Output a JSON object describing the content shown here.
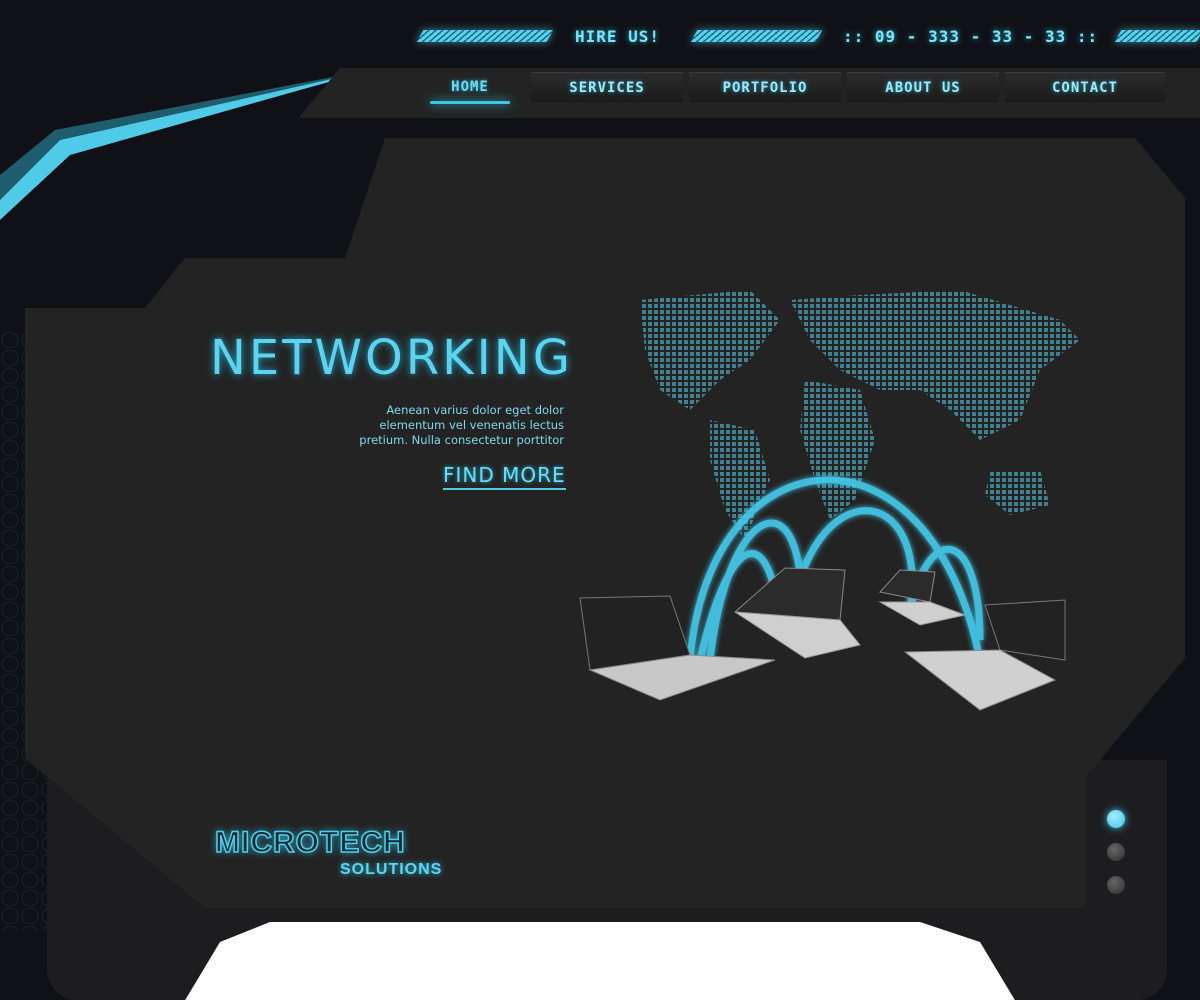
{
  "header": {
    "hire_label": "HIRE US!",
    "phone": ":: 09 - 333 - 33 - 33 ::"
  },
  "nav": {
    "items": [
      {
        "label": "HOME",
        "active": true
      },
      {
        "label": "SERVICES",
        "active": false
      },
      {
        "label": "PORTFOLIO",
        "active": false
      },
      {
        "label": "ABOUT US",
        "active": false
      },
      {
        "label": "CONTACT",
        "active": false
      }
    ]
  },
  "hero": {
    "title": "NETWORKING",
    "description_lines": [
      "Aenean varius dolor eget dolor",
      "elementum vel venenatis lectus",
      "pretium. Nulla consectetur porttitor"
    ],
    "cta_label": "FIND MORE",
    "illustration_icon": "world-map-network-laptops-icon"
  },
  "logo": {
    "main": "MICROTECH",
    "sub": "SOLUTIONS"
  },
  "slider": {
    "slide_count": 3,
    "active_index": 0
  },
  "colors": {
    "accent": "#5dd3ef",
    "background": "#101116",
    "panel": "#232323"
  }
}
